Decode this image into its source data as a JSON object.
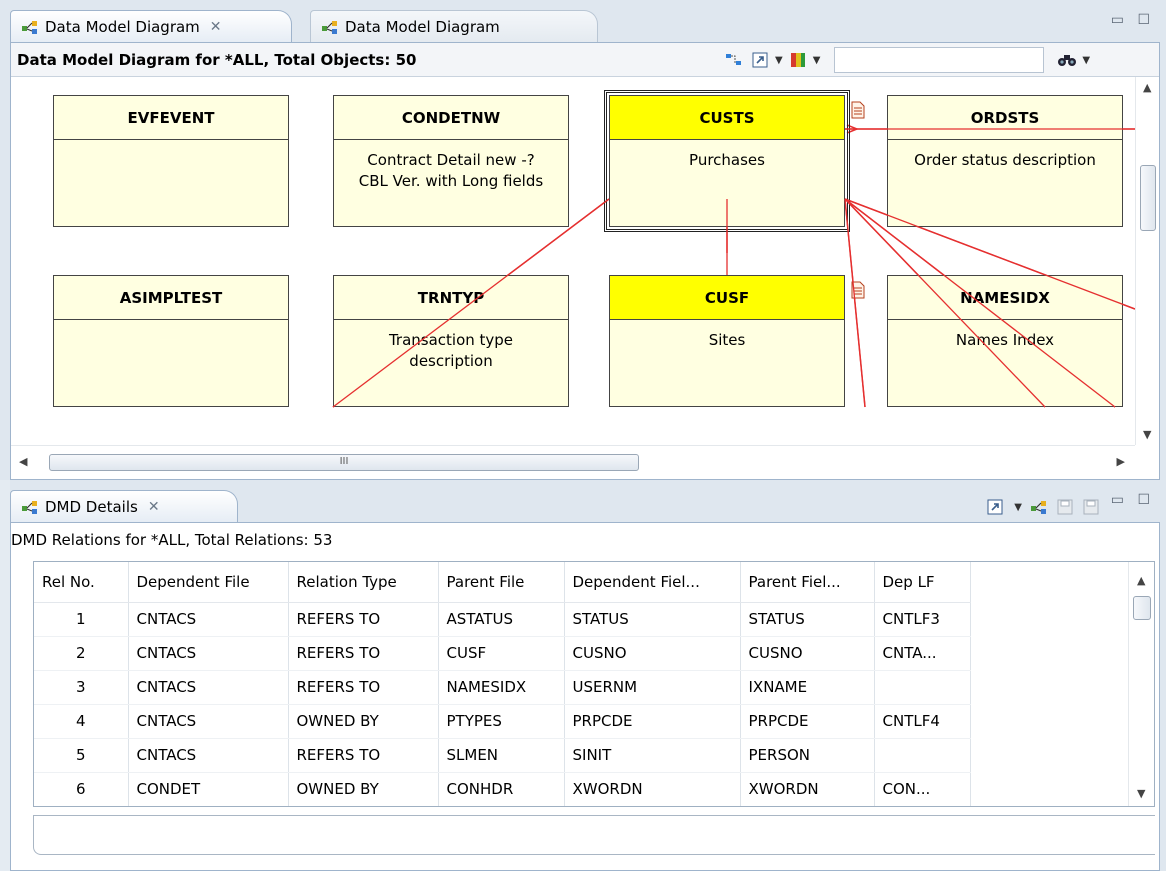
{
  "top_tabs": [
    {
      "label": "Data Model Diagram",
      "active": true
    },
    {
      "label": "Data Model Diagram",
      "active": false
    }
  ],
  "diagram": {
    "subtitle": "Data Model Diagram for *ALL, Total Objects: 50",
    "search_value": "",
    "entities": [
      {
        "name": "EVFEVENT",
        "desc": [],
        "highlighted": false
      },
      {
        "name": "CONDETNW",
        "desc": [
          "Contract Detail new -?",
          "CBL Ver. with Long fields"
        ],
        "highlighted": false
      },
      {
        "name": "CUSTS",
        "desc": [
          "Purchases"
        ],
        "highlighted": true
      },
      {
        "name": "ORDSTS",
        "desc": [
          "Order status description"
        ],
        "highlighted": false
      },
      {
        "name": "ASIMPLTEST",
        "desc": [],
        "highlighted": false
      },
      {
        "name": "TRNTYP",
        "desc": [
          "Transaction type",
          "description"
        ],
        "highlighted": false
      },
      {
        "name": "CUSF",
        "desc": [
          "Sites"
        ],
        "highlighted": true
      },
      {
        "name": "NAMESIDX",
        "desc": [
          "Names Index"
        ],
        "highlighted": false
      }
    ],
    "hscroll_grip": "III",
    "colors": {
      "highlight": "#ffff00",
      "entity_bg": "#ffffe1",
      "relation_line": "#e53030"
    }
  },
  "bottom_tab": {
    "label": "DMD Details"
  },
  "details": {
    "title": "DMD Relations for *ALL, Total Relations: 53",
    "columns": [
      "Rel No.",
      "Dependent File",
      "Relation Type",
      "Parent File",
      "Dependent Fiel...",
      "Parent Fiel...",
      "Dep LF"
    ],
    "rows": [
      [
        "1",
        "CNTACS",
        "REFERS TO",
        "ASTATUS",
        "STATUS",
        "STATUS",
        "CNTLF3"
      ],
      [
        "2",
        "CNTACS",
        "REFERS TO",
        "CUSF",
        "CUSNO",
        "CUSNO",
        "CNTA..."
      ],
      [
        "3",
        "CNTACS",
        "REFERS TO",
        "NAMESIDX",
        "USERNM",
        "IXNAME",
        ""
      ],
      [
        "4",
        "CNTACS",
        "OWNED BY",
        "PTYPES",
        "PRPCDE",
        "PRPCDE",
        "CNTLF4"
      ],
      [
        "5",
        "CNTACS",
        "REFERS TO",
        "SLMEN",
        "SINIT",
        "PERSON",
        ""
      ],
      [
        "6",
        "CONDET",
        "OWNED BY",
        "CONHDR",
        "XWORDN",
        "XWORDN",
        "CON..."
      ]
    ]
  }
}
